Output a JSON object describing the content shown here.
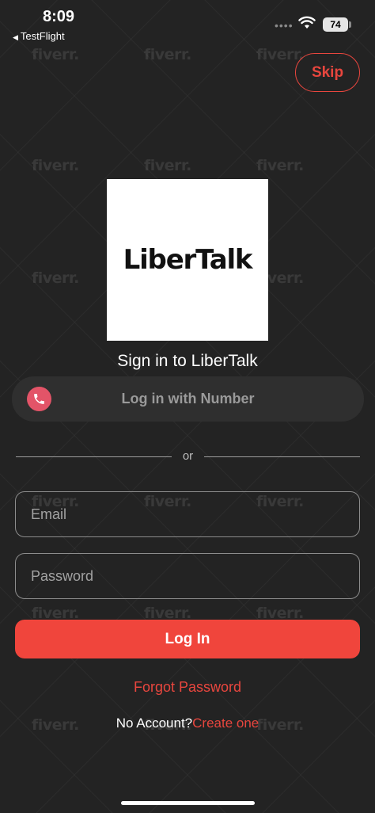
{
  "status_bar": {
    "time": "8:09",
    "back_app": "TestFlight",
    "signal": "••••",
    "battery": "74"
  },
  "watermark_text": "fiverr.",
  "header": {
    "skip_label": "Skip"
  },
  "logo": {
    "text": "LiberTalk"
  },
  "signin": {
    "title": "Sign in to LiberTalk",
    "phone_button_label": "Log in with Number",
    "or_label": "or",
    "email_placeholder": "Email",
    "password_placeholder": "Password",
    "login_label": "Log In",
    "forgot_label": "Forgot Password",
    "no_account_label": "No Account?",
    "create_label": "Create one"
  },
  "colors": {
    "background": "#232323",
    "accent": "#f0453c",
    "phone_icon_bg": "#e35468"
  }
}
